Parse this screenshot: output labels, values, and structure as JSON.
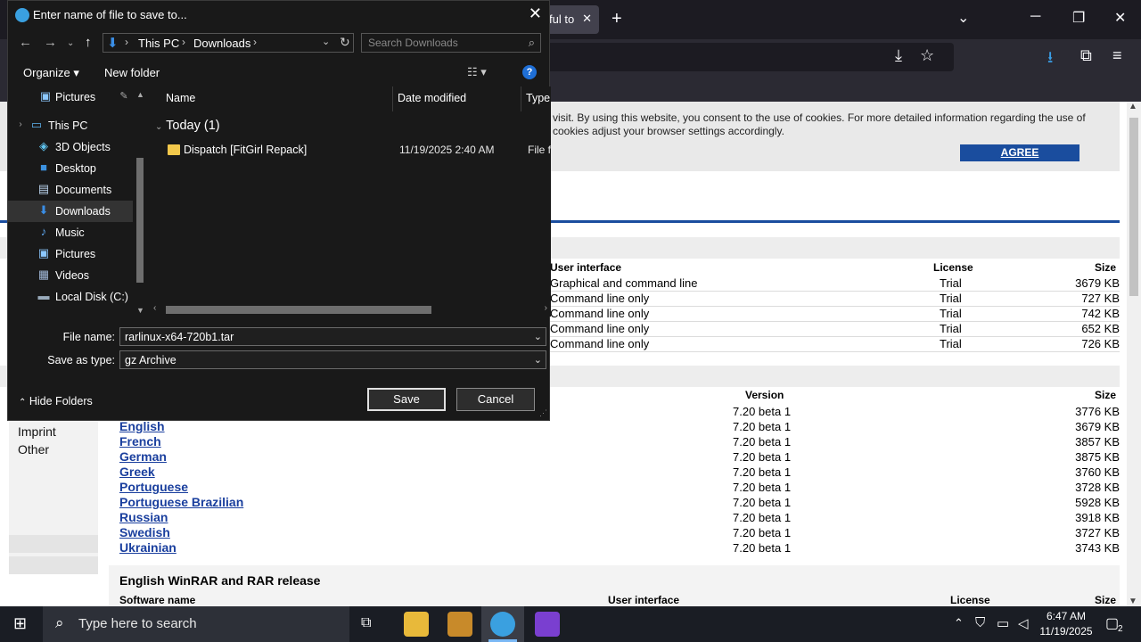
{
  "browser": {
    "tab_title": "ful to",
    "tab_close": "✕",
    "new_tab": "+",
    "window_controls": {
      "menu": "⌄",
      "minimize": "─",
      "restore": "❐",
      "close": "✕"
    }
  },
  "page": {
    "cookie_text": "visit. By using this website, you consent to the use of cookies. For more detailed information regarding the use of cookies adjust your browser settings accordingly.",
    "agree_label": "AGREE",
    "table1": {
      "headers": {
        "ui": "User interface",
        "license": "License",
        "size": "Size"
      },
      "rows": [
        {
          "ui": "Graphical and command line",
          "license": "Trial",
          "size": "3679 KB"
        },
        {
          "ui": "Command line only",
          "license": "Trial",
          "size": "727 KB"
        },
        {
          "ui": "Command line only",
          "license": "Trial",
          "size": "742 KB"
        },
        {
          "ui": "Command line only",
          "license": "Trial",
          "size": "652 KB"
        },
        {
          "ui": "Command line only",
          "license": "Trial",
          "size": "726 KB"
        }
      ]
    },
    "table2": {
      "headers": {
        "version": "Version",
        "size": "Size"
      },
      "rows": [
        {
          "name": "",
          "version": "7.20 beta 1",
          "size": "3776 KB"
        },
        {
          "name": "English",
          "version": "7.20 beta 1",
          "size": "3679 KB"
        },
        {
          "name": "French",
          "version": "7.20 beta 1",
          "size": "3857 KB"
        },
        {
          "name": "German",
          "version": "7.20 beta 1",
          "size": "3875 KB"
        },
        {
          "name": "Greek",
          "version": "7.20 beta 1",
          "size": "3760 KB"
        },
        {
          "name": "Portuguese",
          "version": "7.20 beta 1",
          "size": "3728 KB"
        },
        {
          "name": "Portuguese Brazilian",
          "version": "7.20 beta 1",
          "size": "5928 KB"
        },
        {
          "name": "Russian",
          "version": "7.20 beta 1",
          "size": "3918 KB"
        },
        {
          "name": "Swedish",
          "version": "7.20 beta 1",
          "size": "3727 KB"
        },
        {
          "name": "Ukrainian",
          "version": "7.20 beta 1",
          "size": "3743 KB"
        }
      ]
    },
    "sidebar": {
      "imprint": "Imprint",
      "other": "Other"
    },
    "section_title": "English WinRAR and RAR release",
    "table3_headers": {
      "name": "Software name",
      "ui": "User interface",
      "license": "License",
      "size": "Size"
    }
  },
  "dialog": {
    "title": "Enter name of file to save to...",
    "breadcrumb": [
      "This PC",
      "Downloads"
    ],
    "search_placeholder": "Search Downloads",
    "organize_label": "Organize",
    "new_folder_label": "New folder",
    "help_glyph": "?",
    "nav_items": [
      {
        "label": "Pictures",
        "icon": "pictures-icon"
      },
      {
        "label": "This PC",
        "icon": "computer-icon"
      },
      {
        "label": "3D Objects",
        "icon": "cube-icon"
      },
      {
        "label": "Desktop",
        "icon": "desktop-icon"
      },
      {
        "label": "Documents",
        "icon": "documents-icon"
      },
      {
        "label": "Downloads",
        "icon": "download-icon"
      },
      {
        "label": "Music",
        "icon": "music-icon"
      },
      {
        "label": "Pictures",
        "icon": "pictures-icon"
      },
      {
        "label": "Videos",
        "icon": "videos-icon"
      },
      {
        "label": "Local Disk (C:)",
        "icon": "disk-icon"
      }
    ],
    "columns": {
      "name": "Name",
      "date": "Date modified",
      "type": "Type"
    },
    "group_label": "Today (1)",
    "files": [
      {
        "name": "Dispatch [FitGirl Repack]",
        "date": "11/19/2025 2:40 AM",
        "type": "File fo"
      }
    ],
    "file_name_label": "File name:",
    "file_name_value": "rarlinux-x64-720b1.tar",
    "save_type_label": "Save as type:",
    "save_type_value": "gz Archive",
    "hide_folders_label": "Hide Folders",
    "save_label": "Save",
    "cancel_label": "Cancel"
  },
  "taskbar": {
    "search_placeholder": "Type here to search",
    "time": "6:47 AM",
    "date": "11/19/2025",
    "notification_count": "2"
  },
  "colors": {
    "accent": "#1a4d9e",
    "dialog_bg": "#191919",
    "link": "#1a3f9e"
  }
}
